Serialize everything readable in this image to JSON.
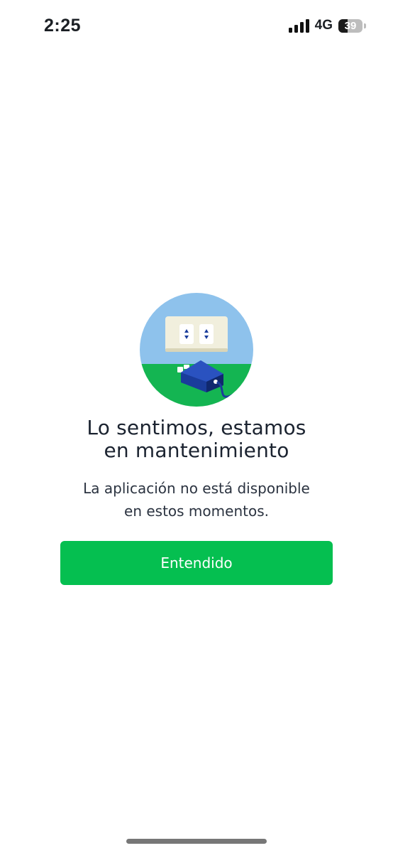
{
  "status_bar": {
    "time": "2:25",
    "network": "4G",
    "battery_percent": "39",
    "battery_level": 0.39,
    "signal_icon": "cellular-signal-icon"
  },
  "illustration": {
    "icon": "unplugged-outlet-illustration",
    "colors": {
      "sky": "#8ec2ec",
      "grass": "#14b552",
      "outlet": "#f1efdd",
      "plug": "#1a3c9b"
    }
  },
  "message": {
    "title_line1": "Lo sentimos, estamos",
    "title_line2": "en mantenimiento",
    "body_line1": "La aplicación no está disponible",
    "body_line2": "en estos momentos."
  },
  "actions": {
    "confirm_label": "Entendido"
  },
  "colors": {
    "accent": "#05bf50",
    "text": "#1b2330"
  }
}
